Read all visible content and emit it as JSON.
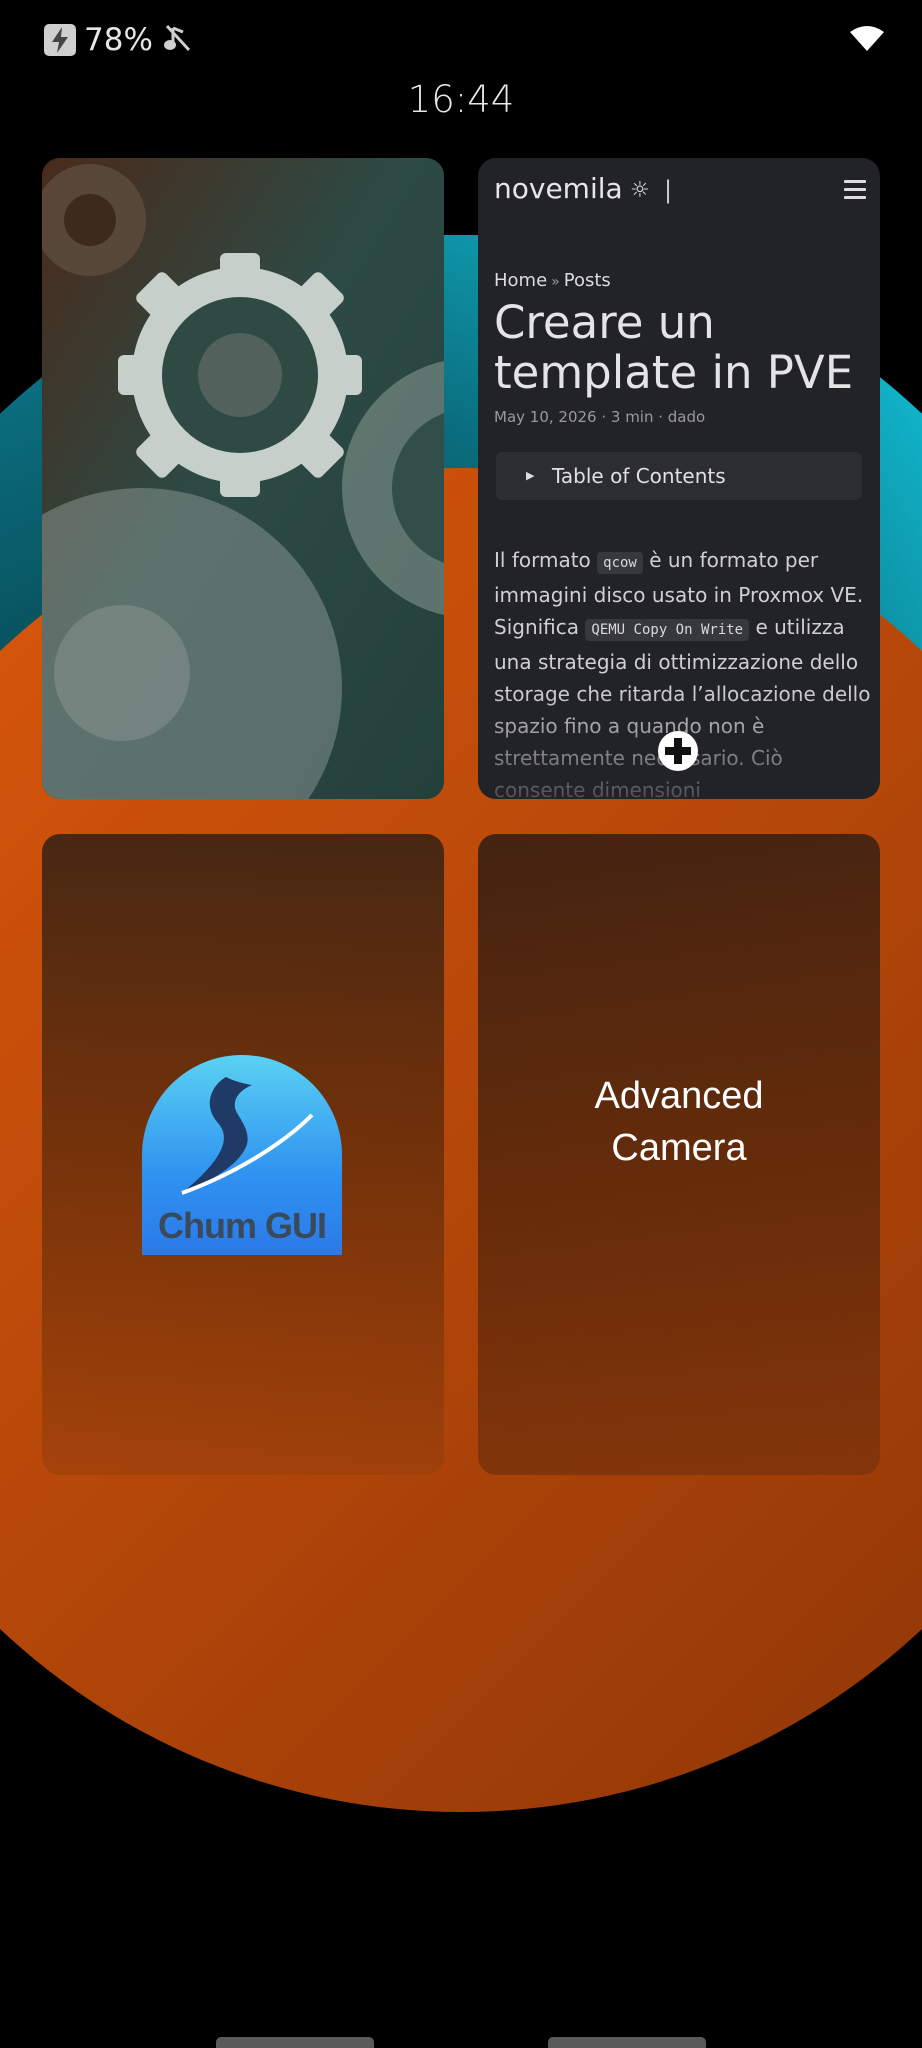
{
  "status_bar": {
    "battery": "78%",
    "time": "16:44",
    "icons": [
      "charging-bolt-icon",
      "music-off-icon",
      "wifi-icon"
    ]
  },
  "cards": {
    "settings": {
      "icon": "gears-icon"
    },
    "browser": {
      "site_name": "novemila",
      "breadcrumb": [
        "Home",
        "Posts"
      ],
      "post_title": "Creare un template in PVE",
      "meta": "May 10, 2026 · 3 min · dado",
      "toc_label": "Table of Contents",
      "body_1": "Il formato ",
      "code_1": "qcow",
      "body_2": " è un formato per immagini disco usato in Proxmox VE. Significa ",
      "code_2": "QEMU Copy On Write",
      "body_3": " e utilizza una strategia di ottimizzazione dello storage che ritarda l’allocazione dello spazio fino a quando non è strettamente necessario. Ciò consente dimensioni"
    },
    "chum": {
      "logo_text": "Chum GUI"
    },
    "camera": {
      "title_line1": "Advanced",
      "title_line2": "Camera"
    }
  },
  "colors": {
    "teal": "#10c4e0",
    "orange": "#d5530c",
    "background": "#000000"
  }
}
